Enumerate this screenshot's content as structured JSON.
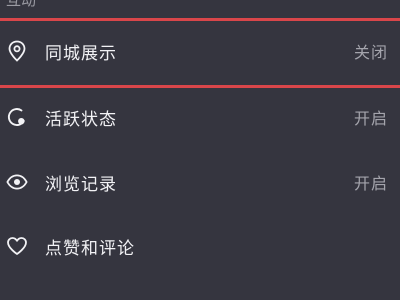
{
  "section": {
    "header": "互动"
  },
  "settings": [
    {
      "label": "同城展示",
      "value": "关闭",
      "icon": "location-pin-icon"
    },
    {
      "label": "活跃状态",
      "value": "开启",
      "icon": "active-status-icon"
    },
    {
      "label": "浏览记录",
      "value": "开启",
      "icon": "eye-icon"
    },
    {
      "label": "点赞和评论",
      "value": "",
      "icon": "heart-icon"
    }
  ],
  "colors": {
    "background": "#35353f",
    "highlight": "#d9464a",
    "text": "#f2f2f5",
    "value_text": "#a4a4ac"
  }
}
